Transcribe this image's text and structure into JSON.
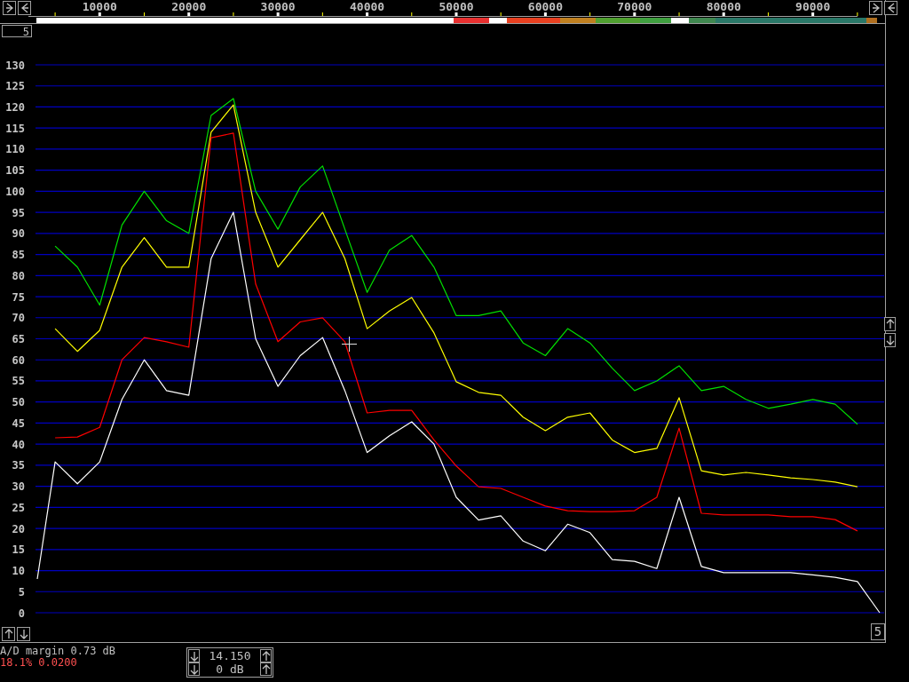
{
  "scale_box": {
    "value": "5"
  },
  "chart": {
    "chart_data": {
      "type": "line",
      "xlim": [
        2800,
        98000
      ],
      "ylim": [
        0,
        130
      ],
      "grid": true,
      "xticks": [
        10000,
        20000,
        30000,
        40000,
        50000,
        60000,
        70000,
        80000,
        90000
      ],
      "yticks": [
        0,
        5,
        10,
        15,
        20,
        25,
        30,
        35,
        40,
        45,
        50,
        55,
        60,
        65,
        70,
        75,
        80,
        85,
        90,
        95,
        100,
        105,
        110,
        115,
        120,
        125,
        130
      ],
      "x": [
        3000,
        5000,
        7500,
        10000,
        12500,
        15000,
        17500,
        20000,
        22500,
        25000,
        27500,
        30000,
        32500,
        35000,
        37500,
        40000,
        42500,
        45000,
        47500,
        50000,
        52500,
        55000,
        57500,
        60000,
        62500,
        65000,
        67500,
        70000,
        72500,
        75000,
        77500,
        80000,
        82500,
        85000,
        87500,
        90000,
        92500,
        95000,
        97500
      ],
      "series": [
        {
          "color": "#00e000",
          "values": [
            null,
            87,
            82,
            73,
            92,
            100,
            93,
            90,
            118,
            122,
            100,
            91,
            101,
            106,
            91,
            76,
            86,
            89.5,
            82,
            70.5,
            70.5,
            71.6,
            64,
            61,
            67.4,
            64,
            58,
            52.7,
            55,
            58.6,
            52.7,
            53.7,
            50.6,
            48.5,
            49.5,
            50.6,
            49.5,
            44.7,
            null
          ]
        },
        {
          "color": "#ffff00",
          "values": [
            null,
            67.4,
            62,
            67,
            82,
            89,
            82,
            82,
            114,
            120.5,
            95,
            82,
            88.5,
            95,
            84,
            67.4,
            71.6,
            74.8,
            66.4,
            54.8,
            52.3,
            51.6,
            46.4,
            43.2,
            46.4,
            47.4,
            41,
            38,
            39,
            51,
            33.7,
            32.7,
            33.3,
            32.7,
            32,
            31.6,
            31,
            29.9,
            null
          ]
        },
        {
          "color": "#ff0000",
          "values": [
            null,
            41.5,
            41.7,
            44,
            60,
            65.3,
            64.3,
            63,
            112.7,
            113.8,
            78,
            64.3,
            69,
            70,
            64.3,
            47.4,
            48,
            48,
            41,
            34.8,
            29.9,
            29.5,
            27.4,
            25.3,
            24.2,
            24,
            24,
            24.2,
            27.4,
            43.8,
            23.6,
            23.2,
            23.2,
            23.2,
            22.8,
            22.8,
            22.1,
            19.4,
            null
          ]
        },
        {
          "color": "#ffffff",
          "values": [
            8,
            35.8,
            30.6,
            35.8,
            50.6,
            60,
            52.7,
            51.6,
            84,
            95,
            65,
            53.7,
            61,
            65.3,
            52.7,
            38,
            42,
            45.3,
            40,
            27.4,
            22,
            23,
            17,
            14.7,
            21,
            19,
            12.6,
            12.2,
            10.5,
            27.4,
            11,
            9.5,
            9.5,
            9.5,
            9.5,
            9,
            8.4,
            7.4,
            0
          ]
        }
      ]
    }
  },
  "corner_box": {
    "value": "5"
  },
  "status": {
    "ad_margin": "A/D margin 0.73 dB",
    "level_readout": "18.1% 0.0200"
  },
  "gain_control": {
    "rows": [
      {
        "value": "14.150"
      },
      {
        "value": "0 dB"
      }
    ]
  }
}
